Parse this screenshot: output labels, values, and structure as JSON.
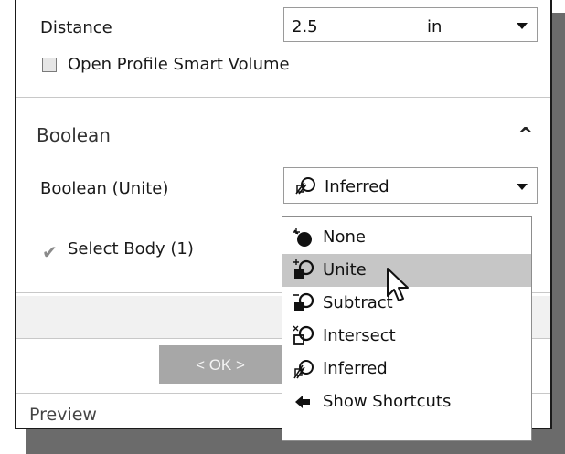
{
  "distance": {
    "label": "Distance",
    "value": "2.5",
    "unit": "in"
  },
  "open_profile": {
    "label": "Open Profile Smart Volume",
    "checked": false
  },
  "boolean": {
    "section_title": "Boolean",
    "field_label": "Boolean (Unite)",
    "selected": "Inferred",
    "select_body": "Select Body (1)"
  },
  "ok_label": "< OK >",
  "preview_label": "Preview",
  "menu": {
    "items": [
      {
        "label": "None",
        "icon": "none-boolean-icon"
      },
      {
        "label": "Unite",
        "icon": "unite-boolean-icon",
        "highlighted": true
      },
      {
        "label": "Subtract",
        "icon": "subtract-boolean-icon"
      },
      {
        "label": "Intersect",
        "icon": "intersect-boolean-icon"
      },
      {
        "label": "Inferred",
        "icon": "inferred-boolean-icon"
      },
      {
        "label": "Show Shortcuts",
        "icon": "arrow-left-icon"
      }
    ]
  }
}
